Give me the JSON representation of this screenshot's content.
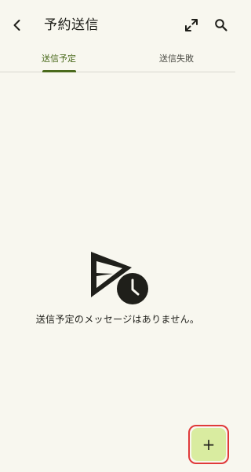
{
  "appbar": {
    "title": "予約送信",
    "back_icon": "arrow-back-icon",
    "expand_icon": "expand-icon",
    "search_icon": "search-icon"
  },
  "tabs": [
    {
      "label": "送信予定",
      "selected": true
    },
    {
      "label": "送信失敗",
      "selected": false
    }
  ],
  "empty_state": {
    "icon": "scheduled-send-icon",
    "message": "送信予定のメッセージはありません。"
  },
  "fab": {
    "label": "+",
    "icon": "add-icon"
  },
  "colors": {
    "background": "#f8f7ef",
    "accent": "#4a6a1c",
    "fab_bg": "#d9eca0",
    "highlight": "#e03a3a"
  }
}
